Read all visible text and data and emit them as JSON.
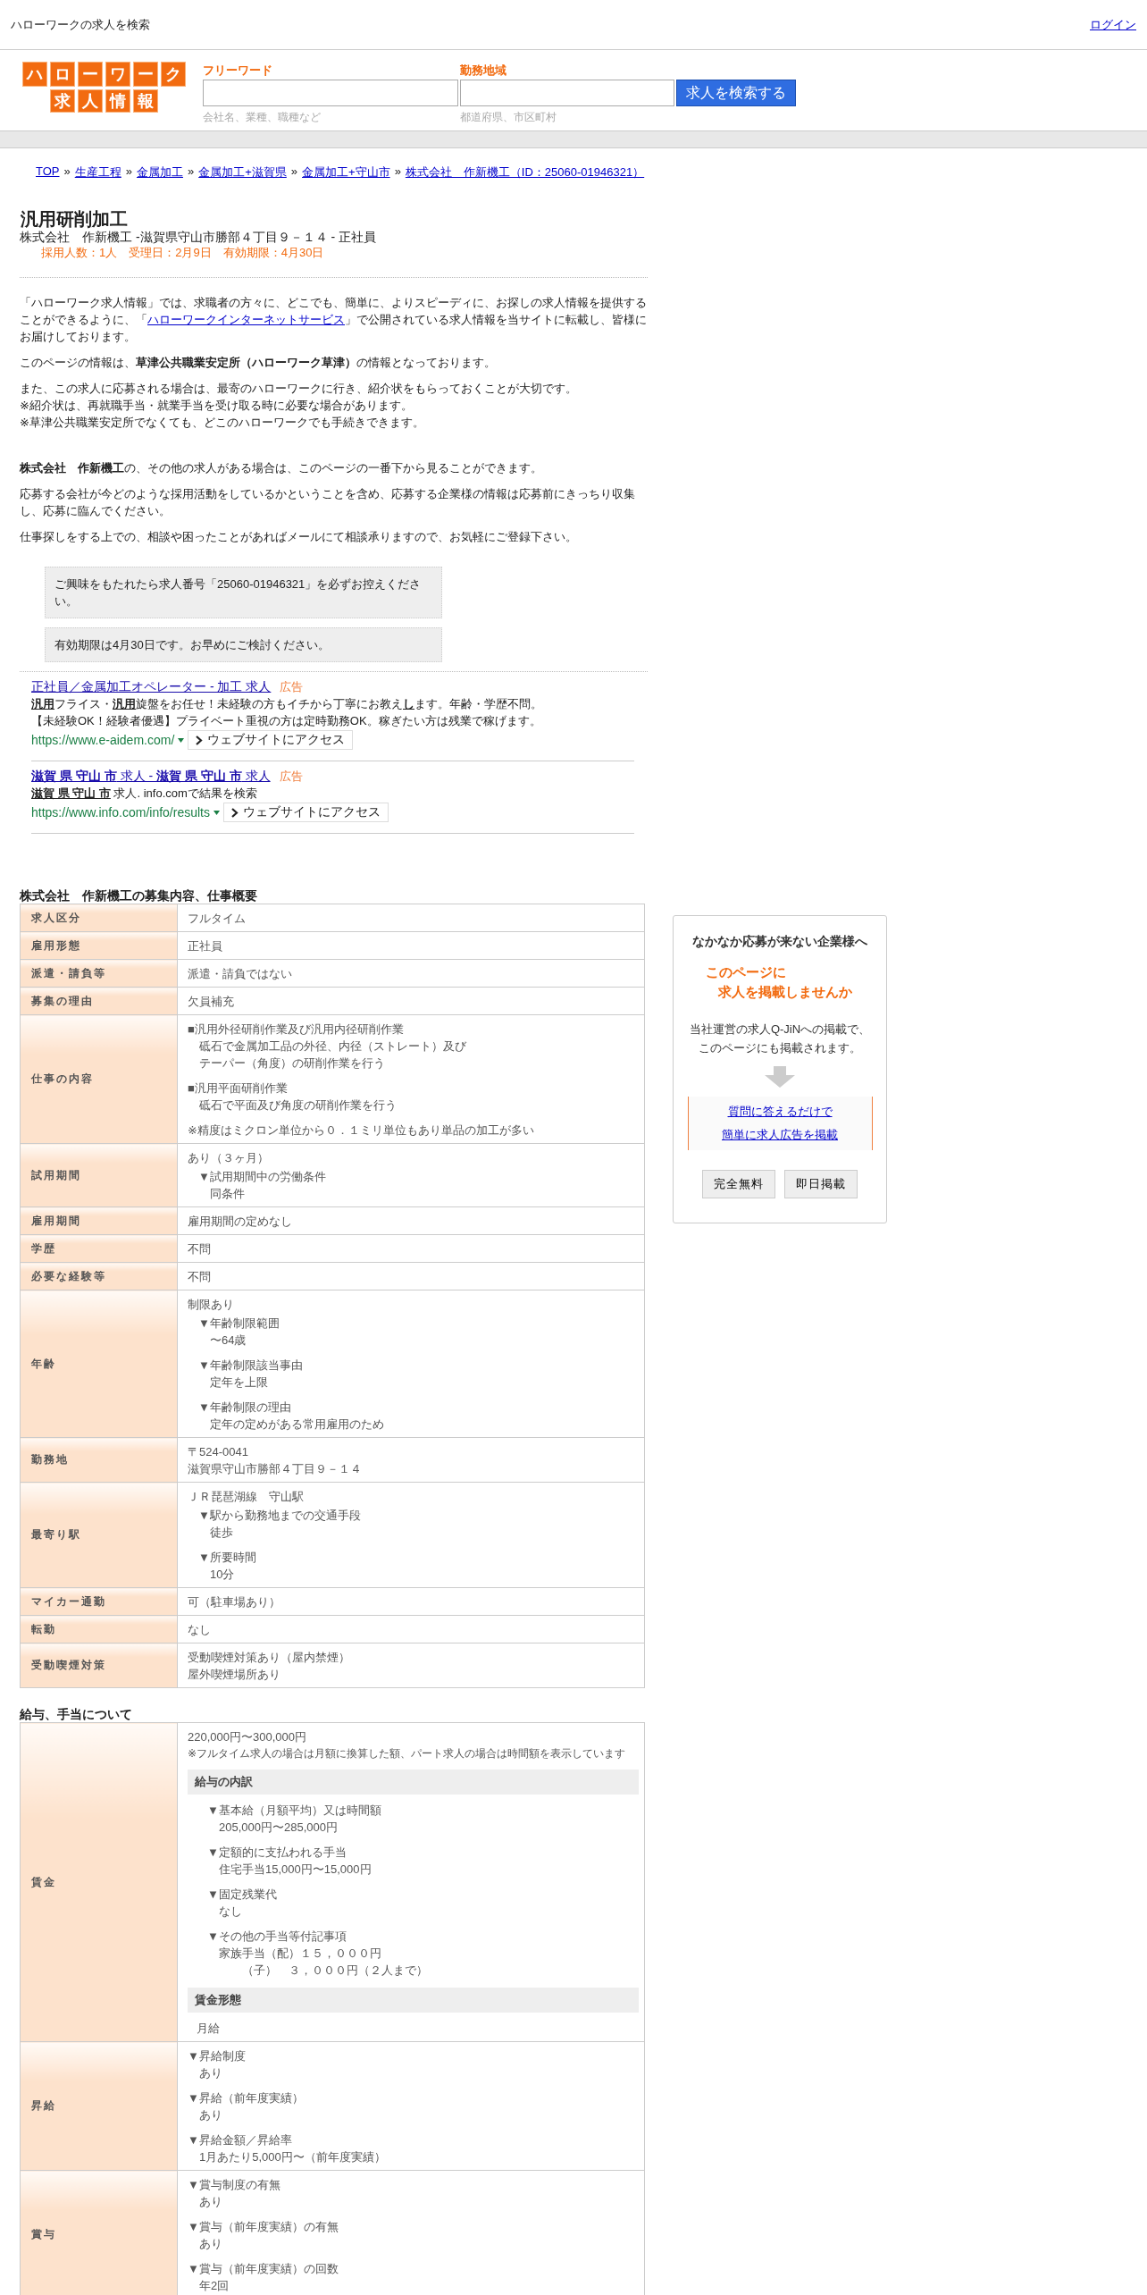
{
  "header": {
    "site_title": "ハローワークの求人を検索",
    "login": "ログイン"
  },
  "logo": {
    "lines": [
      "ハローワーク",
      "求人情報"
    ]
  },
  "search": {
    "fields": [
      {
        "label": "フリーワード",
        "hint": "会社名、業種、職種など"
      },
      {
        "label": "勤務地域",
        "hint": "都道府県、市区町村"
      }
    ],
    "button": "求人を検索する"
  },
  "breadcrumb": {
    "separator": "»",
    "items": [
      "TOP",
      "生産工程",
      "金属加工",
      "金属加工+滋賀県",
      "金属加工+守山市",
      "株式会社　作新機工（ID：25060-01946321）"
    ]
  },
  "job": {
    "title": "汎用研削加工",
    "subtitle": "株式会社　作新機工 -滋賀県守山市勝部４丁目９－１４ - 正社員",
    "meta": "採用人数：1人　受理日：2月9日　有効期限：4月30日"
  },
  "intro": [
    {
      "parts": [
        {
          "kind": "text",
          "text": "「ハローワーク求人情報」では、求職者の方々に、どこでも、簡単に、よりスピーディに、お探しの求人情報を提供することができるように、「"
        },
        {
          "kind": "link",
          "text": "ハローワークインターネットサービス"
        },
        {
          "kind": "text",
          "text": "」で公開されている求人情報を当サイトに転載し、皆様にお届けしております。"
        }
      ]
    },
    {
      "parts": [
        {
          "kind": "text",
          "text": "このページの情報は、**草津公共職業安定所（ハローワーク草津）**の情報となっております。"
        }
      ]
    },
    {
      "parts": [
        {
          "kind": "text",
          "text": "また、この求人に応募される場合は、最寄のハローワークに行き、紹介状をもらっておくことが大切です。"
        },
        {
          "kind": "break"
        },
        {
          "kind": "text",
          "text": "※紹介状は、再就職手当・就業手当を受け取る時に必要な場合があります。"
        },
        {
          "kind": "break"
        },
        {
          "kind": "text",
          "text": "※草津公共職業安定所でなくても、どこのハローワークでも手続きできます。"
        }
      ]
    },
    {
      "parts": [
        {
          "kind": "text",
          "text": "**株式会社　作新機工**の、その他の求人がある場合は、このページの一番下から見ることができます。"
        }
      ]
    },
    {
      "parts": [
        {
          "kind": "text",
          "text": "応募する会社が今どのような採用活動をしているかということを含め、応募する企業様の情報は応募前にきっちり収集し、応募に臨んでください。"
        }
      ]
    },
    {
      "parts": [
        {
          "kind": "text",
          "text": "仕事探しをする上での、相談や困ったことがあればメールにて相談承りますので、お気軽にご登録下さい。"
        }
      ]
    }
  ],
  "notices": [
    "ご興味をもたれたら求人番号「25060-01946321」を必ずお控えください。",
    "有効期限は4月30日です。お早めにご検討ください。"
  ],
  "ads": [
    {
      "title": "正社員／金属加工オペレーター - 加工 求人",
      "badge": "広告",
      "lines": [
        "**汎用**フライス・**汎用**旋盤をお任せ！未経験の方もイチから丁寧にお教え**し**ます。年齢・学歴不問。",
        "【未経験OK！経験者優遇】プライベート重視の方は定時勤務OK。稼ぎたい方は残業で稼げます。"
      ],
      "url": "https://www.e-aidem.com/",
      "button": "ウェブサイトにアクセス"
    },
    {
      "title": "**滋賀 県 守山 市** 求人 - **滋賀 県 守山 市** 求人",
      "badge": "広告",
      "lines": [
        "**滋賀 県 守山 市** 求人. info.comで結果を検索"
      ],
      "url": "https://www.info.com/info/results",
      "button": "ウェブサイトにアクセス"
    }
  ],
  "sections": [
    {
      "title": "株式会社　作新機工の募集内容、仕事概要",
      "rows": [
        {
          "label": "求人区分",
          "paras": [
            {
              "kind": "plain",
              "lines": [
                "フルタイム"
              ]
            }
          ]
        },
        {
          "label": "雇用形態",
          "paras": [
            {
              "kind": "plain",
              "lines": [
                "正社員"
              ]
            }
          ]
        },
        {
          "label": "派遣・請負等",
          "paras": [
            {
              "kind": "plain",
              "lines": [
                "派遣・請負ではない"
              ]
            }
          ]
        },
        {
          "label": "募集の理由",
          "paras": [
            {
              "kind": "plain",
              "lines": [
                "欠員補充"
              ]
            }
          ]
        },
        {
          "label": "仕事の内容",
          "paras": [
            {
              "kind": "item",
              "lines": [
                "■汎用外径研削作業及び汎用内径研削作業",
                "砥石で金属加工品の外径、内径（ストレート）及び",
                "テーパー（角度）の研削作業を行う"
              ]
            },
            {
              "kind": "item",
              "lines": [
                "■汎用平面研削作業",
                "砥石で平面及び角度の研削作業を行う"
              ]
            },
            {
              "kind": "plain",
              "lines": [
                "※精度はミクロン単位から０．１ミリ単位もあり単品の加工が多い"
              ]
            }
          ]
        },
        {
          "label": "試用期間",
          "paras": [
            {
              "kind": "plain",
              "lines": [
                "あり（３ヶ月）"
              ]
            },
            {
              "kind": "sub_item",
              "lines": [
                "▼試用期間中の労働条件",
                "同条件"
              ]
            }
          ]
        },
        {
          "label": "雇用期間",
          "paras": [
            {
              "kind": "plain",
              "lines": [
                "雇用期間の定めなし"
              ]
            }
          ]
        },
        {
          "label": "学歴",
          "paras": [
            {
              "kind": "plain",
              "lines": [
                "不問"
              ]
            }
          ]
        },
        {
          "label": "必要な経験等",
          "paras": [
            {
              "kind": "plain",
              "lines": [
                "不問"
              ]
            }
          ]
        },
        {
          "label": "年齢",
          "paras": [
            {
              "kind": "plain",
              "lines": [
                "制限あり"
              ]
            },
            {
              "kind": "sub_item",
              "lines": [
                "▼年齢制限範囲",
                "〜64歳"
              ]
            },
            {
              "kind": "sub_item",
              "lines": [
                "▼年齢制限該当事由",
                "定年を上限"
              ]
            },
            {
              "kind": "sub_item",
              "lines": [
                "▼年齢制限の理由",
                "定年の定めがある常用雇用のため"
              ]
            }
          ]
        },
        {
          "label": "勤務地",
          "paras": [
            {
              "kind": "plain",
              "lines": [
                "〒524-0041",
                "滋賀県守山市勝部４丁目９－１４"
              ]
            }
          ]
        },
        {
          "label": "最寄り駅",
          "paras": [
            {
              "kind": "plain",
              "lines": [
                "ＪＲ琵琶湖線　守山駅"
              ]
            },
            {
              "kind": "sub_item",
              "lines": [
                "▼駅から勤務地までの交通手段",
                "徒歩"
              ]
            },
            {
              "kind": "sub_item",
              "lines": [
                "▼所要時間",
                "10分"
              ]
            }
          ]
        },
        {
          "label": "マイカー通勤",
          "paras": [
            {
              "kind": "plain",
              "lines": [
                "可（駐車場あり）"
              ]
            }
          ]
        },
        {
          "label": "転勤",
          "paras": [
            {
              "kind": "plain",
              "lines": [
                "なし"
              ]
            }
          ]
        },
        {
          "label": "受動喫煙対策",
          "paras": [
            {
              "kind": "plain",
              "lines": [
                "受動喫煙対策あり（屋内禁煙）",
                "屋外喫煙場所あり"
              ]
            }
          ]
        }
      ]
    },
    {
      "title": "給与、手当について",
      "rows": [
        {
          "label": "賃金",
          "paras": [
            {
              "kind": "plain",
              "lines": [
                "220,000円〜300,000円"
              ]
            },
            {
              "kind": "note",
              "lines": [
                "※フルタイム求人の場合は月額に換算した額、パート求人の場合は時間額を表示しています"
              ]
            },
            {
              "kind": "section",
              "lines": [
                "給与の内訳"
              ]
            },
            {
              "kind": "deep_item",
              "lines": [
                "▼基本給（月額平均）又は時間額",
                "205,000円〜285,000円"
              ]
            },
            {
              "kind": "deep_item",
              "lines": [
                "▼定額的に支払われる手当",
                "住宅手当15,000円〜15,000円"
              ]
            },
            {
              "kind": "deep_item",
              "lines": [
                "▼固定残業代",
                "なし"
              ]
            },
            {
              "kind": "deep_item",
              "lines": [
                "▼その他の手当等付記事項",
                "家族手当（配）１５，０００円",
                "　　（子）　３，０００円（２人まで）"
              ]
            },
            {
              "kind": "section",
              "lines": [
                "賃金形態"
              ]
            },
            {
              "kind": "sub",
              "lines": [
                "月給"
              ]
            }
          ]
        },
        {
          "label": "昇給",
          "paras": [
            {
              "kind": "item",
              "lines": [
                "▼昇給制度",
                "あり"
              ]
            },
            {
              "kind": "item",
              "lines": [
                "▼昇給（前年度実績）",
                "あり"
              ]
            },
            {
              "kind": "item",
              "lines": [
                "▼昇給金額／昇給率",
                "1月あたり5,000円〜（前年度実績）"
              ]
            }
          ]
        },
        {
          "label": "賞与",
          "paras": [
            {
              "kind": "item",
              "lines": [
                "▼賞与制度の有無",
                "あり"
              ]
            },
            {
              "kind": "item",
              "lines": [
                "▼賞与（前年度実績）の有無",
                "あり"
              ]
            },
            {
              "kind": "item",
              "lines": [
                "▼賞与（前年度実績）の回数",
                "年2回"
              ]
            }
          ]
        }
      ]
    }
  ],
  "promo": {
    "title": "なかなか応募が来ない企業様へ",
    "catch": [
      "このページに",
      "求人を掲載しませんか"
    ],
    "description": [
      "当社運営の求人Q-JiNへの掲載で、",
      "このページにも掲載されます。"
    ],
    "links": [
      "質問に答えるだけで",
      "簡単に求人広告を掲載"
    ],
    "buttons": [
      "完全無料",
      "即日掲載"
    ]
  }
}
